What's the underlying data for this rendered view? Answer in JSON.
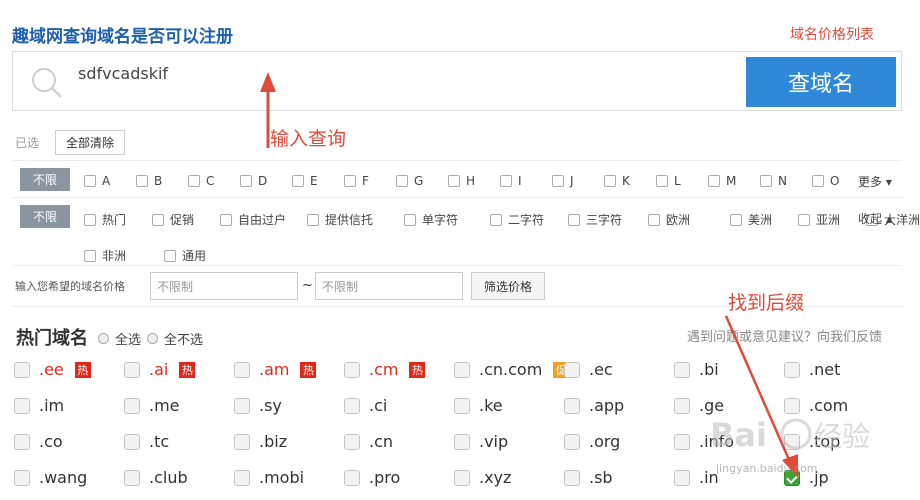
{
  "header": {
    "title": "趣域网查询域名是否可以注册",
    "price_link": "域名价格列表"
  },
  "search": {
    "value": "sdfvcadskif",
    "button_label": "查域名"
  },
  "annotations": {
    "input_hint": "输入查询",
    "suffix_hint": "找到后缀"
  },
  "selected": {
    "label": "已选",
    "clear_label": "全部清除"
  },
  "filter_letters": {
    "tag": "不限",
    "letters": [
      "A",
      "B",
      "C",
      "D",
      "E",
      "F",
      "G",
      "H",
      "I",
      "J",
      "K",
      "L",
      "M",
      "N",
      "O"
    ],
    "more_label": "更多 ▾"
  },
  "filter_categories": {
    "tag": "不限",
    "items": [
      "热门",
      "促销",
      "自由过户",
      "提供信托",
      "单字符",
      "二字符",
      "三字符",
      "欧洲",
      "美洲",
      "亚洲",
      "大洋洲",
      "非洲",
      "通用"
    ],
    "collapse_label": "收起 ▴"
  },
  "price_filter": {
    "label": "输入您希望的域名价格",
    "min_placeholder": "不限制",
    "separator": "~",
    "max_placeholder": "不限制",
    "button_label": "筛选价格"
  },
  "hot_domains": {
    "title": "热门域名",
    "select_all": "全选",
    "select_none": "全不选",
    "feedback": "遇到问题或意见建议？向我们反馈",
    "rows": [
      [
        {
          "name": ".ee",
          "badge": "热",
          "red": true
        },
        {
          "name": ".ai",
          "badge": "热",
          "red": true
        },
        {
          "name": ".am",
          "badge": "热",
          "red": true
        },
        {
          "name": ".cm",
          "badge": "热",
          "red": true
        },
        {
          "name": ".cn.com",
          "badge": "促"
        },
        {
          "name": ".ec"
        },
        {
          "name": ".bi"
        },
        {
          "name": ".net"
        }
      ],
      [
        {
          "name": ".im"
        },
        {
          "name": ".me"
        },
        {
          "name": ".sy"
        },
        {
          "name": ".ci"
        },
        {
          "name": ".ke"
        },
        {
          "name": ".app"
        },
        {
          "name": ".ge"
        },
        {
          "name": ".com"
        }
      ],
      [
        {
          "name": ".co"
        },
        {
          "name": ".tc"
        },
        {
          "name": ".biz"
        },
        {
          "name": ".cn"
        },
        {
          "name": ".vip"
        },
        {
          "name": ".org"
        },
        {
          "name": ".info"
        },
        {
          "name": ".top"
        }
      ],
      [
        {
          "name": ".wang"
        },
        {
          "name": ".club"
        },
        {
          "name": ".mobi"
        },
        {
          "name": ".pro"
        },
        {
          "name": ".xyz"
        },
        {
          "name": ".sb"
        },
        {
          "name": ".in"
        },
        {
          "name": ".jp",
          "checked": true
        }
      ]
    ]
  },
  "watermark": {
    "text": "jingyan.baidu.com",
    "brand_left": "Bai",
    "brand_right": "经验"
  },
  "colors": {
    "accent": "#3089d8",
    "annotation": "#e04a3a",
    "title": "#1e5faa",
    "hot_badge": "#e0281a",
    "promo_badge": "#f0a020"
  },
  "icons": {
    "search": "search-icon",
    "checkbox": "checkbox-icon"
  }
}
